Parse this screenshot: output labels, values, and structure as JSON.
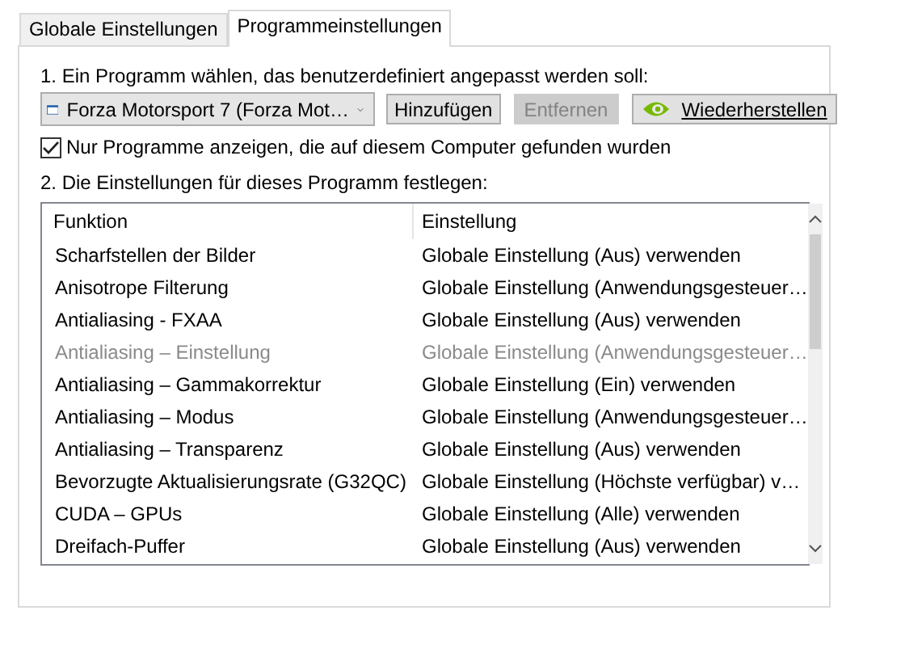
{
  "tabs": [
    {
      "label": "Globale Einstellungen",
      "selected": false
    },
    {
      "label": "Programmeinstellungen",
      "selected": true
    }
  ],
  "step_1_label": "1. Ein Programm wählen, das benutzerdefiniert angepasst werden soll:",
  "program_dropdown": {
    "value": "Forza Motorsport 7 (Forza Mot…"
  },
  "buttons": [
    {
      "kind": "plain",
      "label": "Hinzufügen",
      "disabled": false
    },
    {
      "kind": "plain",
      "label": "Entfernen",
      "disabled": true
    },
    {
      "kind": "logo",
      "label": "Wiederherstellen",
      "disabled": false
    }
  ],
  "filter_checkbox": {
    "label": "Nur Programme anzeigen, die auf diesem Computer gefunden wurden",
    "checked": true
  },
  "step_2_label": "2. Die Einstellungen für dieses Programm festlegen:",
  "table": {
    "columns": [
      "Funktion",
      "Einstellung"
    ],
    "rows": [
      {
        "function": "Scharfstellen der Bilder",
        "setting": "Globale Einstellung (Aus) verwenden",
        "disabled": false
      },
      {
        "function": "Anisotrope Filterung",
        "setting": "Globale Einstellung (Anwendungsgesteuer…",
        "disabled": false
      },
      {
        "function": "Antialiasing - FXAA",
        "setting": "Globale Einstellung (Aus) verwenden",
        "disabled": false
      },
      {
        "function": "Antialiasing – Einstellung",
        "setting": "Globale Einstellung (Anwendungsgesteuer…",
        "disabled": true
      },
      {
        "function": "Antialiasing – Gammakorrektur",
        "setting": "Globale Einstellung (Ein) verwenden",
        "disabled": false
      },
      {
        "function": "Antialiasing – Modus",
        "setting": "Globale Einstellung (Anwendungsgesteuer…",
        "disabled": false
      },
      {
        "function": "Antialiasing – Transparenz",
        "setting": "Globale Einstellung (Aus) verwenden",
        "disabled": false
      },
      {
        "function": "Bevorzugte Aktualisierungsrate (G32QC)",
        "setting": "Globale Einstellung (Höchste verfügbar) v…",
        "disabled": false
      },
      {
        "function": "CUDA – GPUs",
        "setting": "Globale Einstellung (Alle) verwenden",
        "disabled": false
      },
      {
        "function": "Dreifach-Puffer",
        "setting": "Globale Einstellung (Aus) verwenden",
        "disabled": false
      }
    ]
  }
}
